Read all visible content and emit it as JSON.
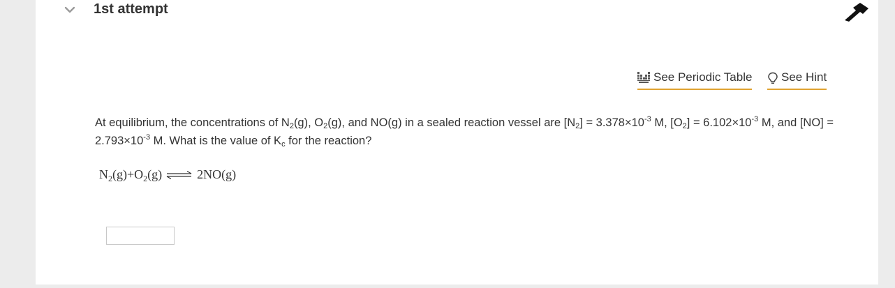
{
  "header": {
    "attempt_title": "1st attempt"
  },
  "toolbar": {
    "periodic_table_label": "See Periodic Table",
    "hint_label": "See Hint"
  },
  "question": {
    "part1": "At equilibrium, the concentrations of N",
    "n2_sub": "2",
    "part2": "(g), O",
    "o2_sub": "2",
    "part3": "(g), and NO(g) in a sealed reaction vessel are [N",
    "n2_sub_b": "2",
    "part4": "] = 3.378×10",
    "exp1": "-3",
    "part5": " M, [O",
    "o2_sub_b": "2",
    "part6": "] = 6.102×10",
    "exp2": "-3",
    "part7": " M, and [NO] = 2.793×10",
    "exp3": "-3",
    "part8": " M. What is the value of K",
    "k_sub": "c",
    "part9": " for the reaction?"
  },
  "equation": {
    "reactant1": "N",
    "reactant1_sub": "2",
    "reactant1_state": "(g)",
    "plus": " + ",
    "reactant2": "O",
    "reactant2_sub": "2",
    "reactant2_state": "(g)",
    "product": "2NO",
    "product_state": "(g)"
  },
  "answer": {
    "value": "",
    "placeholder": ""
  },
  "colors": {
    "background": "#ececec",
    "card": "#ffffff",
    "accent_underline": "#e0a331",
    "text": "#333333"
  },
  "icons": {
    "collapse": "chevron-down-icon",
    "pin": "pin-icon",
    "periodic": "periodic-table-icon",
    "hint": "lightbulb-icon"
  }
}
